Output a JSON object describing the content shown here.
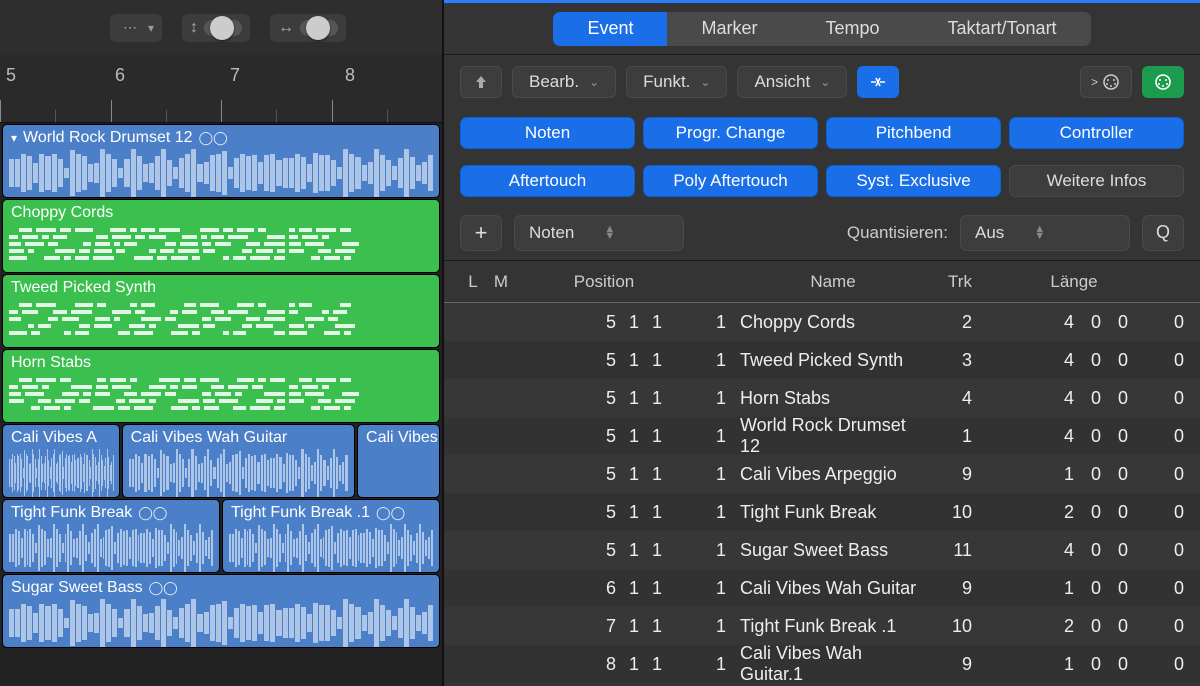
{
  "ruler": {
    "markers": [
      "5",
      "6",
      "7",
      "8"
    ]
  },
  "regions": {
    "drums": {
      "title": "World Rock Drumset 12",
      "loop": true
    },
    "chords": {
      "title": "Choppy Cords"
    },
    "synth": {
      "title": "Tweed Picked Synth"
    },
    "horns": {
      "title": "Horn Stabs"
    },
    "cali_a": {
      "title": "Cali Vibes A"
    },
    "cali_wah": {
      "title": "Cali Vibes Wah Guitar"
    },
    "cali_b": {
      "title": "Cali Vibes"
    },
    "funk1": {
      "title": "Tight Funk Break",
      "loop": true
    },
    "funk2": {
      "title": "Tight Funk Break .1",
      "loop": true
    },
    "bass": {
      "title": "Sugar Sweet Bass",
      "loop": true
    }
  },
  "tabs": [
    {
      "label": "Event",
      "active": true
    },
    {
      "label": "Marker",
      "active": false
    },
    {
      "label": "Tempo",
      "active": false
    },
    {
      "label": "Taktart/Tonart",
      "active": false
    }
  ],
  "menus": {
    "edit": "Bearb.",
    "func": "Funkt.",
    "view": "Ansicht"
  },
  "filters": [
    {
      "label": "Noten",
      "active": true
    },
    {
      "label": "Progr. Change",
      "active": true
    },
    {
      "label": "Pitchbend",
      "active": true
    },
    {
      "label": "Controller",
      "active": true
    },
    {
      "label": "Aftertouch",
      "active": true
    },
    {
      "label": "Poly Aftertouch",
      "active": true
    },
    {
      "label": "Syst. Exclusive",
      "active": true
    },
    {
      "label": "Weitere Infos",
      "active": false
    }
  ],
  "add": {
    "type_select": "Noten",
    "quant_label": "Quantisieren:",
    "quant_value": "Aus",
    "q_button": "Q"
  },
  "columns": {
    "l": "L",
    "m": "M",
    "pos": "Position",
    "name": "Name",
    "trk": "Trk",
    "len": "Länge"
  },
  "rows": [
    {
      "pos": "5 1 1",
      "idx": "1",
      "name": "Choppy Cords",
      "trk": "2",
      "len": "4 0 0",
      "last": "0"
    },
    {
      "pos": "5 1 1",
      "idx": "1",
      "name": "Tweed Picked Synth",
      "trk": "3",
      "len": "4 0 0",
      "last": "0"
    },
    {
      "pos": "5 1 1",
      "idx": "1",
      "name": "Horn Stabs",
      "trk": "4",
      "len": "4 0 0",
      "last": "0"
    },
    {
      "pos": "5 1 1",
      "idx": "1",
      "name": "World Rock Drumset 12",
      "trk": "1",
      "len": "4 0 0",
      "last": "0"
    },
    {
      "pos": "5 1 1",
      "idx": "1",
      "name": "Cali Vibes Arpeggio",
      "trk": "9",
      "len": "1 0 0",
      "last": "0"
    },
    {
      "pos": "5 1 1",
      "idx": "1",
      "name": "Tight Funk Break",
      "trk": "10",
      "len": "2 0 0",
      "last": "0"
    },
    {
      "pos": "5 1 1",
      "idx": "1",
      "name": "Sugar Sweet Bass",
      "trk": "11",
      "len": "4 0 0",
      "last": "0"
    },
    {
      "pos": "6 1 1",
      "idx": "1",
      "name": "Cali Vibes Wah Guitar",
      "trk": "9",
      "len": "1 0 0",
      "last": "0"
    },
    {
      "pos": "7 1 1",
      "idx": "1",
      "name": "Tight Funk Break .1",
      "trk": "10",
      "len": "2 0 0",
      "last": "0"
    },
    {
      "pos": "8 1 1",
      "idx": "1",
      "name": "Cali Vibes Wah Guitar.1",
      "trk": "9",
      "len": "1 0 0",
      "last": "0"
    }
  ]
}
